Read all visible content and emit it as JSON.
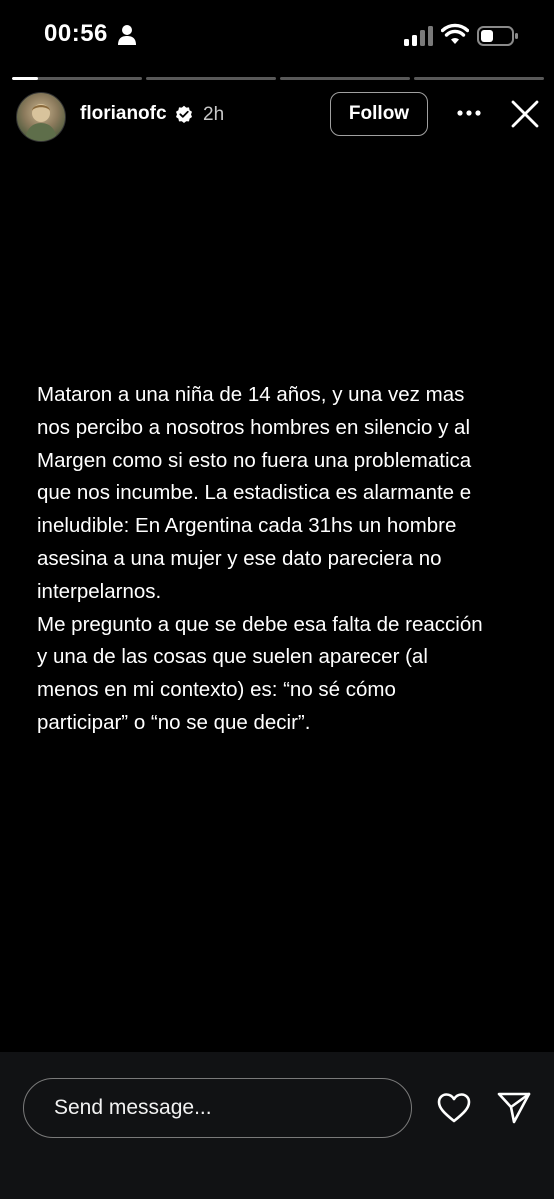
{
  "status_bar": {
    "time": "00:56",
    "icons": [
      "person-icon",
      "cellular-signal-icon",
      "wifi-icon",
      "battery-icon"
    ]
  },
  "story": {
    "progress": {
      "segments": 4,
      "current_index": 0,
      "current_fill": 0.2
    },
    "header": {
      "username": "florianofc",
      "verified": true,
      "time_ago": "2h",
      "follow_label": "Follow"
    },
    "text": "Mataron a una niña de 14 años, y una vez mas\nnos percibo a nosotros hombres en silencio y al\nMargen como si esto no fuera una problematica\nque nos incumbe. La estadistica es alarmante e\nineludible: En Argentina cada 31hs un hombre\nasesina a una mujer y ese dato pareciera no\ninterpelarnos.\nMe pregunto a que se debe esa falta de reacción\ny una de las cosas que suelen aparecer (al\nmenos en mi contexto) es: “no sé cómo\nparticipar” o “no se que decir”."
  },
  "footer": {
    "message_placeholder": "Send message..."
  },
  "colors": {
    "background": "#000000",
    "bottom_bar": "#111214",
    "text": "#ffffff",
    "muted": "#c8c8c8"
  }
}
